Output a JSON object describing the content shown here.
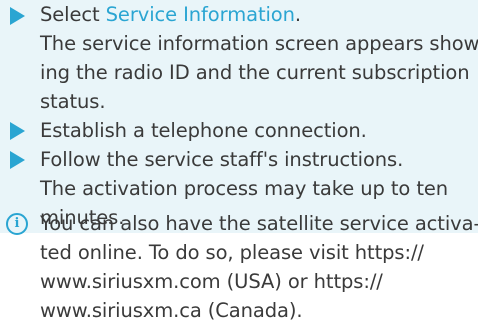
{
  "steps": [
    {
      "prefix": "Select ",
      "link": "Service Information",
      "suffix": ".",
      "result_lines": [
        "The service information screen appears show-",
        "ing the radio ID and the current subscription",
        "status."
      ]
    },
    {
      "text": "Establish a telephone connection."
    },
    {
      "text": "Follow the service staff's instructions.",
      "result_lines": [
        "The activation process may take up to ten",
        "minutes."
      ]
    }
  ],
  "note": {
    "icon": "info-icon",
    "icon_glyph": "i",
    "lines": [
      "You can also have the satellite service activa-",
      "ted online. To do so, please visit https://",
      "www.siriusxm.com (USA) or https://",
      "www.siriusxm.ca (Canada)."
    ]
  },
  "colors": {
    "accent": "#2aa5d2",
    "step_background": "#e9f5f9",
    "text": "#3a3a3a"
  }
}
